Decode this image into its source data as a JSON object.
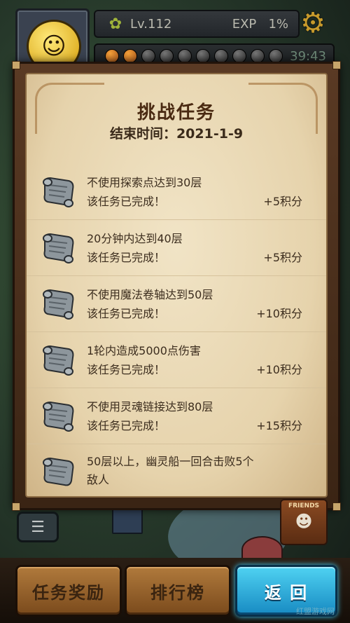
{
  "hud": {
    "level": "Lv.112",
    "exp_label": "EXP",
    "exp_value": "1%",
    "timer": "39:43"
  },
  "panel": {
    "title": "挑战任务",
    "end_time": "结束时间：2021-1-9"
  },
  "quests": [
    {
      "desc": "不使用探索点达到30层",
      "status": "该任务已完成！",
      "reward": "+5积分"
    },
    {
      "desc": "20分钟内达到40层",
      "status": "该任务已完成！",
      "reward": "+5积分"
    },
    {
      "desc": "不使用魔法卷轴达到50层",
      "status": "该任务已完成！",
      "reward": "+10积分"
    },
    {
      "desc": "1轮内造成5000点伤害",
      "status": "该任务已完成！",
      "reward": "+10积分"
    },
    {
      "desc": "不使用灵魂链接达到80层",
      "status": "该任务已完成！",
      "reward": "+15积分"
    },
    {
      "desc": "50层以上，幽灵船一回合击败5个",
      "desc2": "敌人"
    }
  ],
  "friends_label": "FRIENDS",
  "buttons": {
    "rewards": "任务奖励",
    "ranking": "排行榜",
    "back": "返 回"
  },
  "watermark": "红盟游戏网",
  "icons": {
    "settings": "gear-icon",
    "menu": "menu-icon",
    "quest": "scroll-icon"
  }
}
